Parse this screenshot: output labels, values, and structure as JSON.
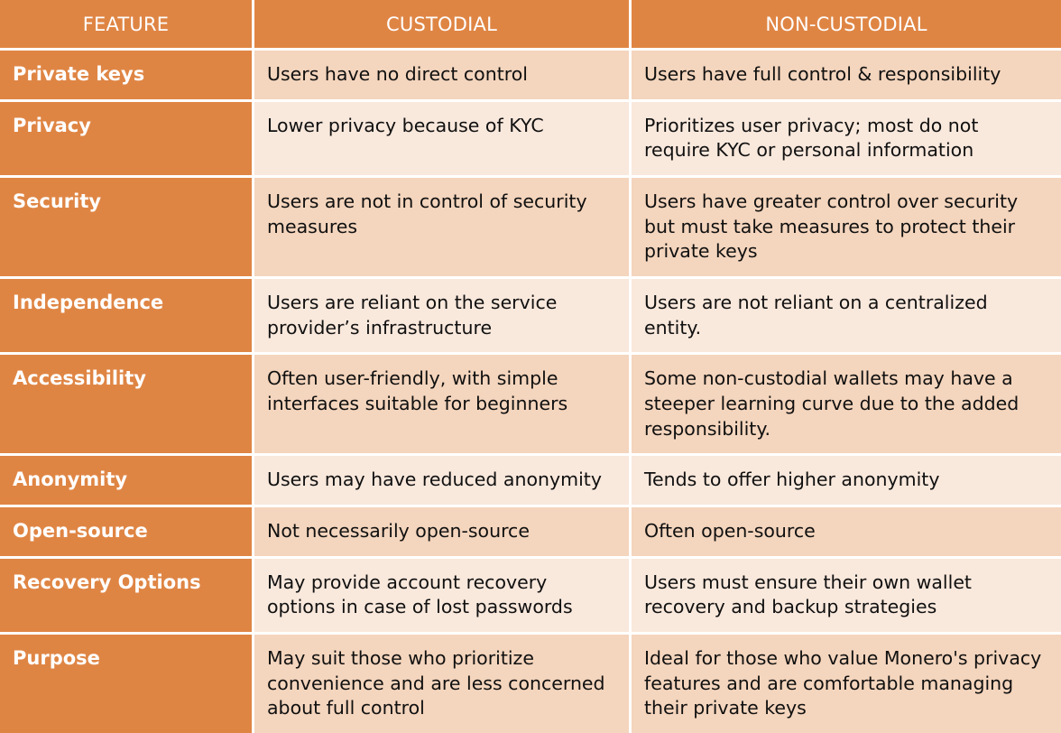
{
  "table": {
    "headers": {
      "feature": "FEATURE",
      "custodial": "CUSTODIAL",
      "non_custodial": "NON-CUSTODIAL"
    },
    "colors": {
      "header_orange": "#df8544",
      "feature_orange": "#df8544",
      "row_dark": "#f4d5bd",
      "row_light": "#f9e8dc",
      "gridline": "#ffffff",
      "header_text": "#ffffff",
      "body_text": "#101010"
    },
    "rows": [
      {
        "feature": "Private keys",
        "custodial": "Users have no direct control",
        "non_custodial": "Users have full control & responsibility"
      },
      {
        "feature": "Privacy",
        "custodial": "Lower privacy because of KYC",
        "non_custodial": "Prioritizes user privacy; most do not require KYC or personal information"
      },
      {
        "feature": "Security",
        "custodial": "Users are not in control of security measures",
        "non_custodial": "Users have greater control over security but must take measures to protect their private keys"
      },
      {
        "feature": "Independence",
        "custodial": "Users are reliant on the service provider’s infrastructure",
        "non_custodial": "Users are not reliant on a centralized entity."
      },
      {
        "feature": "Accessibility",
        "custodial": "Often user-friendly, with simple interfaces suitable for beginners",
        "non_custodial": "Some non-custodial wallets may have a steeper learning curve due to the added responsibility."
      },
      {
        "feature": "Anonymity",
        "custodial": "Users may have reduced anonymity",
        "non_custodial": "Tends to offer higher anonymity"
      },
      {
        "feature": "Open-source",
        "custodial": "Not necessarily open-source",
        "non_custodial": "Often open-source"
      },
      {
        "feature": "Recovery Options",
        "custodial": "May provide account recovery options in case of lost passwords",
        "non_custodial": "Users must ensure their own wallet recovery and backup strategies"
      },
      {
        "feature": "Purpose",
        "custodial": "May suit those who prioritize convenience and are less concerned about full control",
        "non_custodial": "Ideal for those who value Monero's privacy features and are comfortable managing their private keys"
      }
    ]
  }
}
